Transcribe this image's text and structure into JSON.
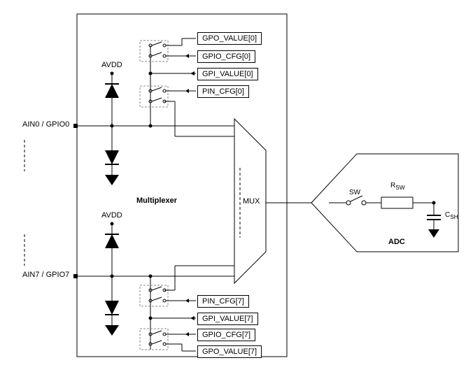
{
  "pins": {
    "top": "AIN0 / GPIO0",
    "bottom": "AIN7 / GPIO7"
  },
  "power": {
    "top": "AVDD",
    "bottom": "AVDD"
  },
  "registers_top": {
    "gpo_value": "GPO_VALUE[0]",
    "gpio_cfg": "GPIO_CFG[0]",
    "gpi_value": "GPI_VALUE[0]",
    "pin_cfg": "PIN_CFG[0]"
  },
  "registers_bottom": {
    "pin_cfg": "PIN_CFG[7]",
    "gpi_value": "GPI_VALUE[7]",
    "gpio_cfg": "GPIO_CFG[7]",
    "gpo_value": "GPO_VALUE[7]"
  },
  "blocks": {
    "multiplexer": "Multiplexer",
    "mux": "MUX",
    "adc": "ADC"
  },
  "adc_components": {
    "sw": "SW",
    "rsw": "R",
    "rsw_sub": "SW",
    "csh": "C",
    "csh_sub": "SH"
  }
}
